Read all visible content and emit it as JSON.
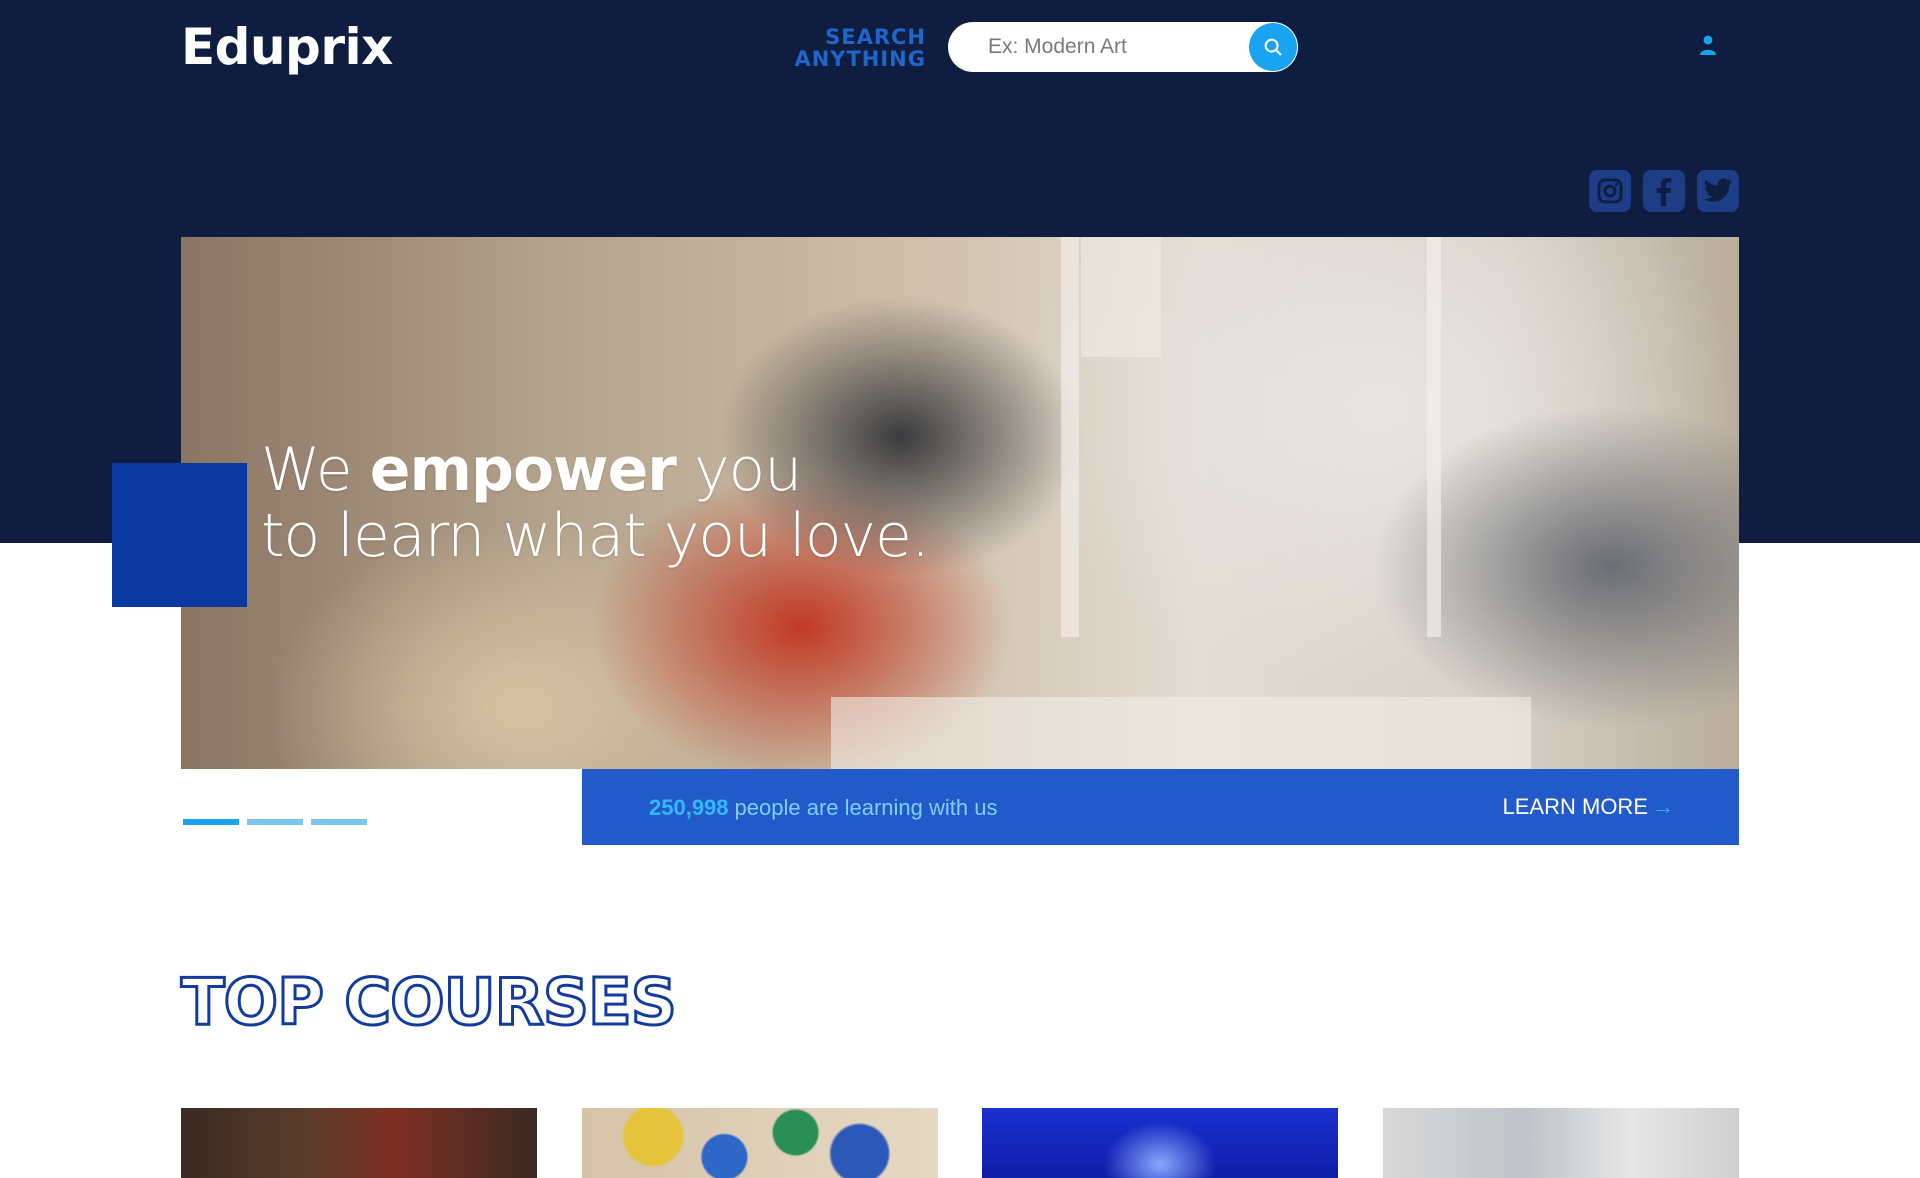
{
  "header": {
    "logo": "Eduprix",
    "search_label": "SEARCH ANYTHING",
    "search_placeholder": "Ex: Modern Art"
  },
  "icons": {
    "search": "search-icon",
    "user": "user-icon",
    "social": [
      "instagram-icon",
      "facebook-icon",
      "twitter-icon"
    ]
  },
  "hero": {
    "headline_line1_pre": "We ",
    "headline_line1_bold": "empower",
    "headline_line1_post": " you",
    "headline_line2": "to learn what you love.",
    "slides_total": 3,
    "active_slide": 1
  },
  "stats": {
    "count": "250,998",
    "text": "people are learning with us",
    "cta": "LEARN MORE"
  },
  "section": {
    "title": "TOP COURSES"
  },
  "colors": {
    "navy": "#0f1d40",
    "brand_blue": "#225bc9",
    "accent_cyan": "#1aa3f0",
    "deep_blue": "#0a37a0"
  }
}
